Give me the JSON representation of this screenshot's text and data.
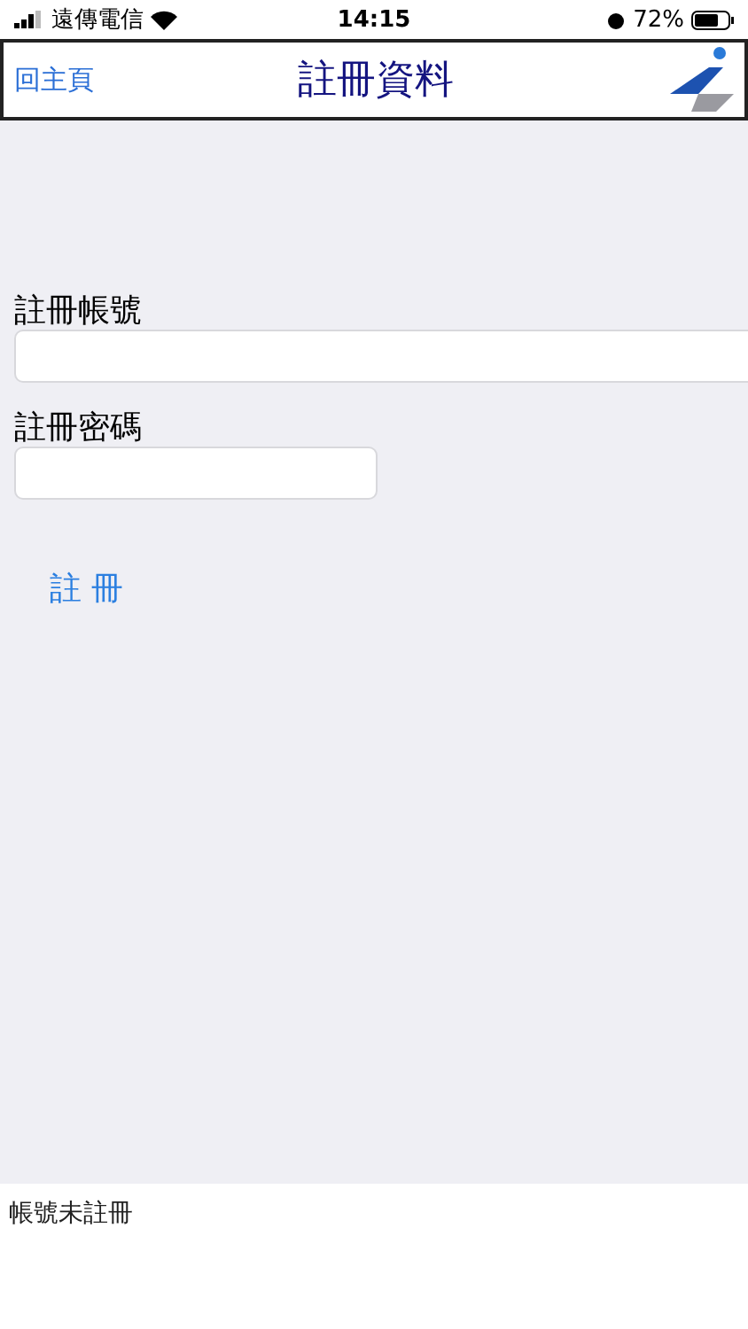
{
  "status_bar": {
    "carrier": "遠傳電信",
    "time": "14:15",
    "battery": "72%"
  },
  "nav_bar": {
    "back": "回主頁",
    "title": "註冊資料"
  },
  "form": {
    "fields": [
      {
        "label": "註冊帳號",
        "kind": "wide"
      },
      {
        "label": "註冊密碼",
        "kind": "narrow"
      }
    ],
    "submit": "註 冊"
  },
  "message": "帳號未註冊"
}
